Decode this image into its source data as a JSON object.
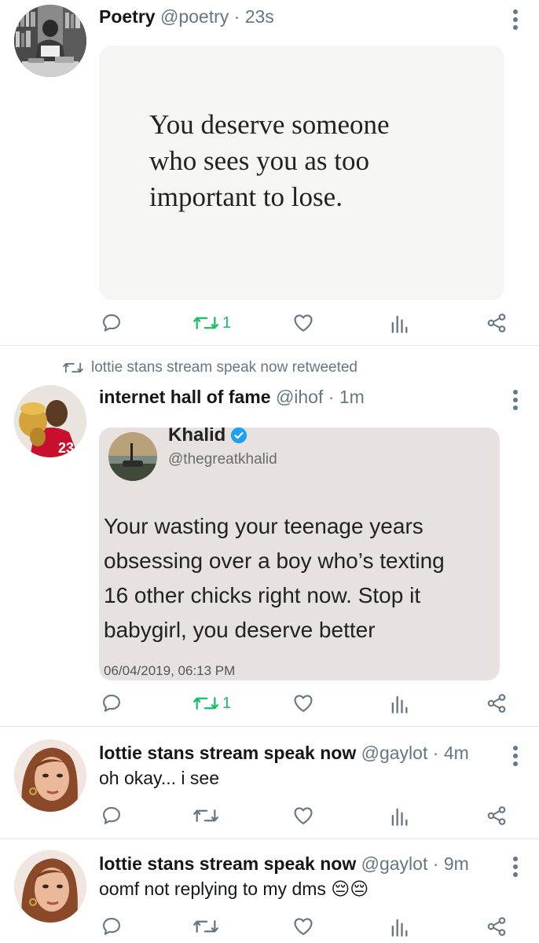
{
  "colors": {
    "retweet_active": "#17bf63",
    "icon_gray": "#657786",
    "divider": "#e1e6ea",
    "verified": "#1da1f2"
  },
  "tweets": [
    {
      "name": "Poetry",
      "handle": "@poetry",
      "time": "23s",
      "separator": "·",
      "avatar": "bookshelf-reading-photo",
      "image_text": [
        "You deserve someone",
        "who sees you as too",
        "important to lose."
      ],
      "retweet_count": "1",
      "retweeted": true
    },
    {
      "retweeted_by": "lottie stans stream speak now retweeted",
      "name": "internet hall of fame",
      "handle": "@ihof",
      "time": "1m",
      "separator": "·",
      "avatar": "basketball-player-trophy-photo",
      "quoted": {
        "name": "Khalid",
        "handle": "@thegreatkhalid",
        "lines": [
          "Your wasting your teenage years",
          "obsessing over a boy who’s texting",
          "16 other chicks right now. Stop it",
          "babygirl, you deserve better"
        ],
        "date": "06/04/2019, 06:13 PM"
      },
      "retweet_count": "1",
      "retweeted": true
    },
    {
      "name": "lottie stans stream speak now",
      "handle": "@gaylot",
      "time": "4m",
      "separator": "·",
      "avatar": "woman-portrait-photo",
      "text": "oh okay... i see"
    },
    {
      "name": "lottie stans stream speak now",
      "handle": "@gaylot",
      "time": "9m",
      "separator": "·",
      "avatar": "woman-portrait-photo",
      "text": "oomf not replying to my dms",
      "emoji": "😔😔"
    }
  ]
}
